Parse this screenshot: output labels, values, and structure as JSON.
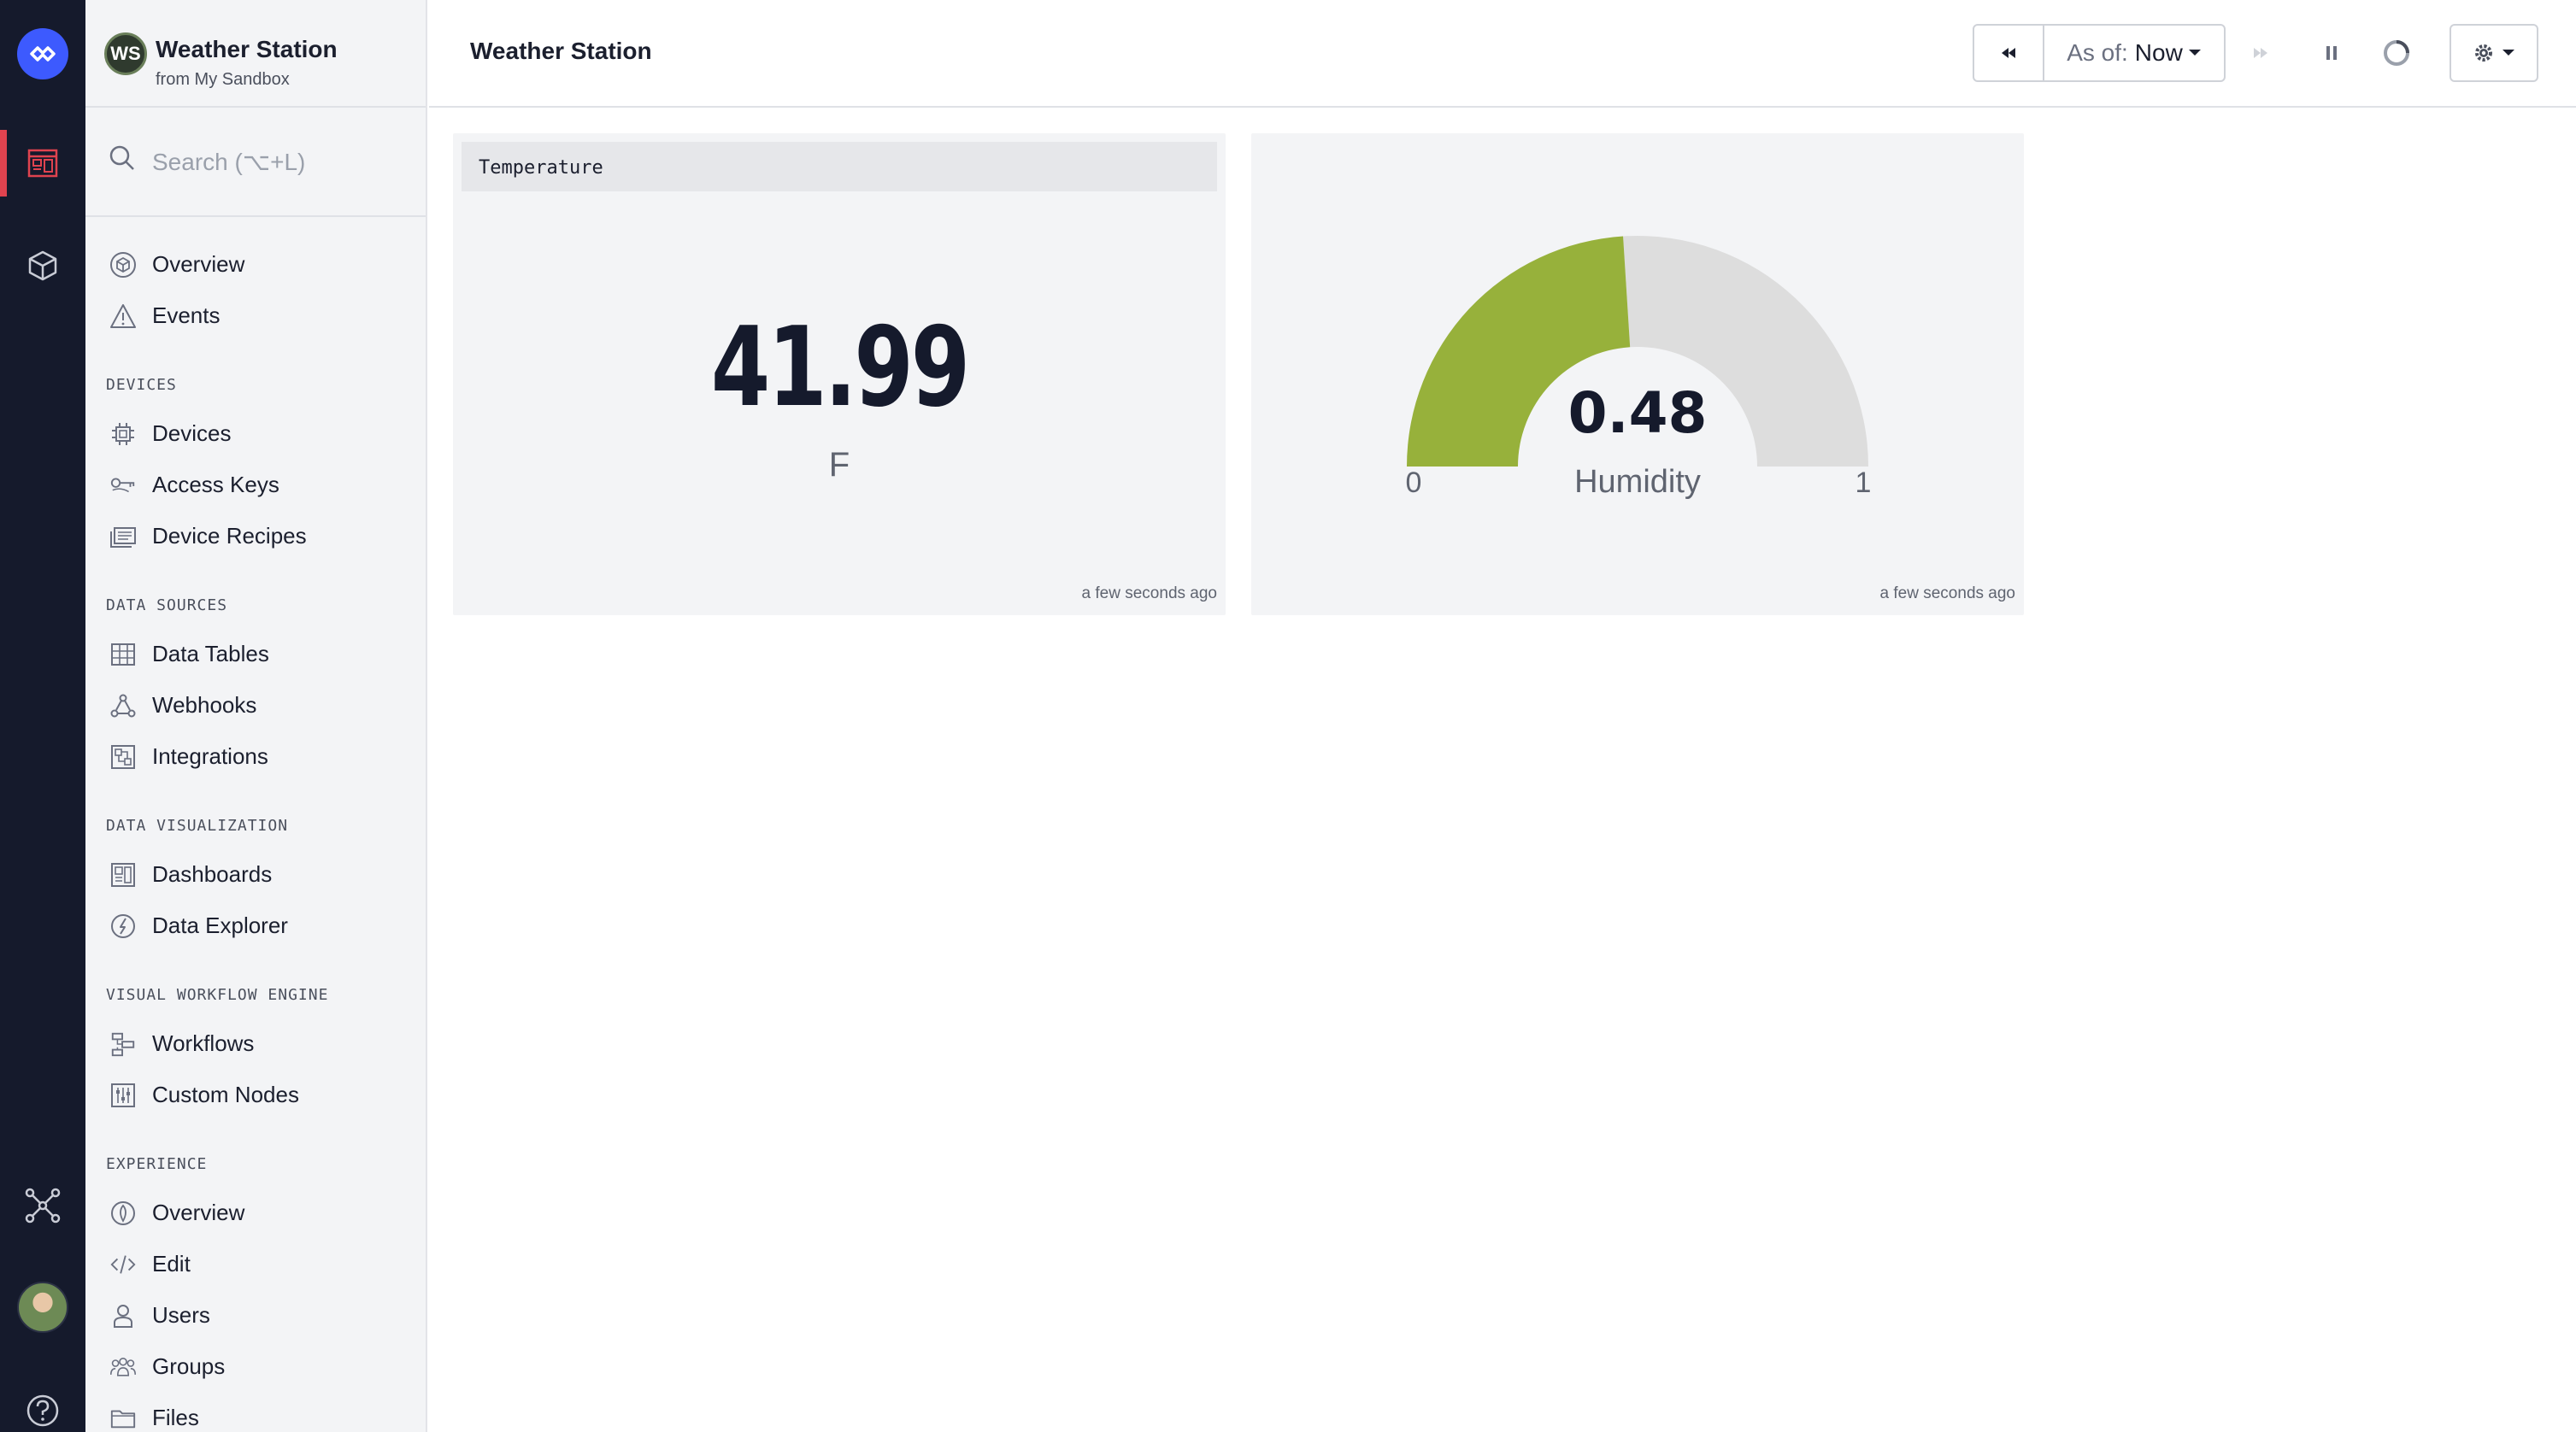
{
  "app": {
    "initials": "WS",
    "name": "Weather Station",
    "subtitle": "from My Sandbox"
  },
  "search": {
    "placeholder": "Search (⌥+L)"
  },
  "nav": {
    "top": [
      {
        "label": "Overview",
        "icon": "cube-circle-icon"
      },
      {
        "label": "Events",
        "icon": "warning-triangle-icon"
      }
    ],
    "sections": [
      {
        "title": "DEVICES",
        "items": [
          {
            "label": "Devices",
            "icon": "chip-icon"
          },
          {
            "label": "Access Keys",
            "icon": "key-icon"
          },
          {
            "label": "Device Recipes",
            "icon": "recipe-icon"
          }
        ]
      },
      {
        "title": "DATA SOURCES",
        "items": [
          {
            "label": "Data Tables",
            "icon": "table-icon"
          },
          {
            "label": "Webhooks",
            "icon": "webhook-icon"
          },
          {
            "label": "Integrations",
            "icon": "integrations-icon"
          }
        ]
      },
      {
        "title": "DATA VISUALIZATION",
        "items": [
          {
            "label": "Dashboards",
            "icon": "dashboard-icon"
          },
          {
            "label": "Data Explorer",
            "icon": "explorer-icon"
          }
        ]
      },
      {
        "title": "VISUAL WORKFLOW ENGINE",
        "items": [
          {
            "label": "Workflows",
            "icon": "workflow-icon"
          },
          {
            "label": "Custom Nodes",
            "icon": "custom-nodes-icon"
          }
        ]
      },
      {
        "title": "EXPERIENCE",
        "items": [
          {
            "label": "Overview",
            "icon": "experience-icon"
          },
          {
            "label": "Edit",
            "icon": "code-icon"
          },
          {
            "label": "Users",
            "icon": "user-icon"
          },
          {
            "label": "Groups",
            "icon": "group-icon"
          },
          {
            "label": "Files",
            "icon": "folder-icon"
          }
        ]
      }
    ]
  },
  "topbar": {
    "title": "Weather Station",
    "as_of_label": "As of:",
    "as_of_value": "Now"
  },
  "cards": {
    "temperature": {
      "title": "Temperature",
      "value": "41.99",
      "unit": "F",
      "updated": "a few seconds ago"
    },
    "humidity": {
      "value": "0.48",
      "label": "Humidity",
      "min": "0",
      "max": "1",
      "fraction": 0.48,
      "updated": "a few seconds ago",
      "fill_color": "#97b13b",
      "track_color": "#dddddd"
    }
  },
  "colors": {
    "rail": "#151a2c",
    "accent": "#3d5afe",
    "active": "#e0434f"
  }
}
